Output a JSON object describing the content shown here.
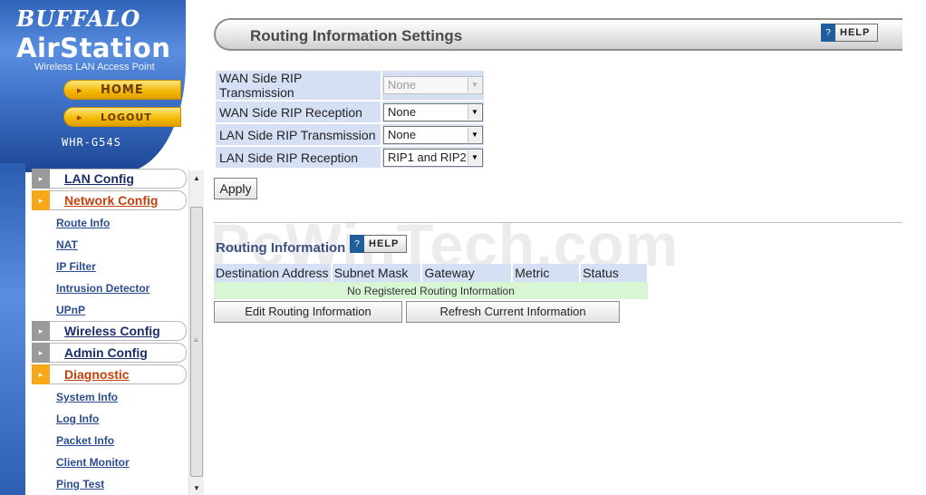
{
  "sidebar": {
    "brand": "BUFFALO",
    "product": "AirStation",
    "subtitle": "Wireless LAN Access Point",
    "home_label": "HOME",
    "logout_label": "LOGOUT",
    "model": "WHR-G54S",
    "menu": [
      {
        "label": "LAN Config",
        "active": false,
        "items": []
      },
      {
        "label": "Network Config",
        "active": true,
        "items": [
          "Route Info",
          "NAT",
          "IP Filter",
          "Intrusion Detector",
          "UPnP"
        ]
      },
      {
        "label": "Wireless Config",
        "active": false,
        "items": []
      },
      {
        "label": "Admin Config",
        "active": false,
        "items": []
      },
      {
        "label": "Diagnostic",
        "active": true,
        "items": [
          "System Info",
          "Log Info",
          "Packet Info",
          "Client Monitor",
          "Ping Test"
        ]
      }
    ]
  },
  "main": {
    "title": "Routing Information Settings",
    "help_label": "HELP",
    "rip_settings": [
      {
        "label": "WAN Side RIP Transmission",
        "value": "None",
        "disabled": true
      },
      {
        "label": "WAN Side RIP Reception",
        "value": "None",
        "disabled": false
      },
      {
        "label": "LAN Side RIP Transmission",
        "value": "None",
        "disabled": false
      },
      {
        "label": "LAN Side RIP Reception",
        "value": "RIP1 and RIP2",
        "disabled": false
      }
    ],
    "apply_label": "Apply",
    "watermark": "PcWinTech.com",
    "routing": {
      "heading": "Routing Information",
      "columns": [
        "Destination Address",
        "Subnet Mask",
        "Gateway",
        "Metric",
        "Status"
      ],
      "empty_message": "No Registered Routing Information",
      "edit_label": "Edit Routing Information",
      "refresh_label": "Refresh Current Information"
    }
  },
  "colors": {
    "accent_orange": "#f7a818",
    "header_blue": "#d5e0f4",
    "empty_row_green": "#d9f6d4",
    "active_menu_text": "#c2410c"
  }
}
